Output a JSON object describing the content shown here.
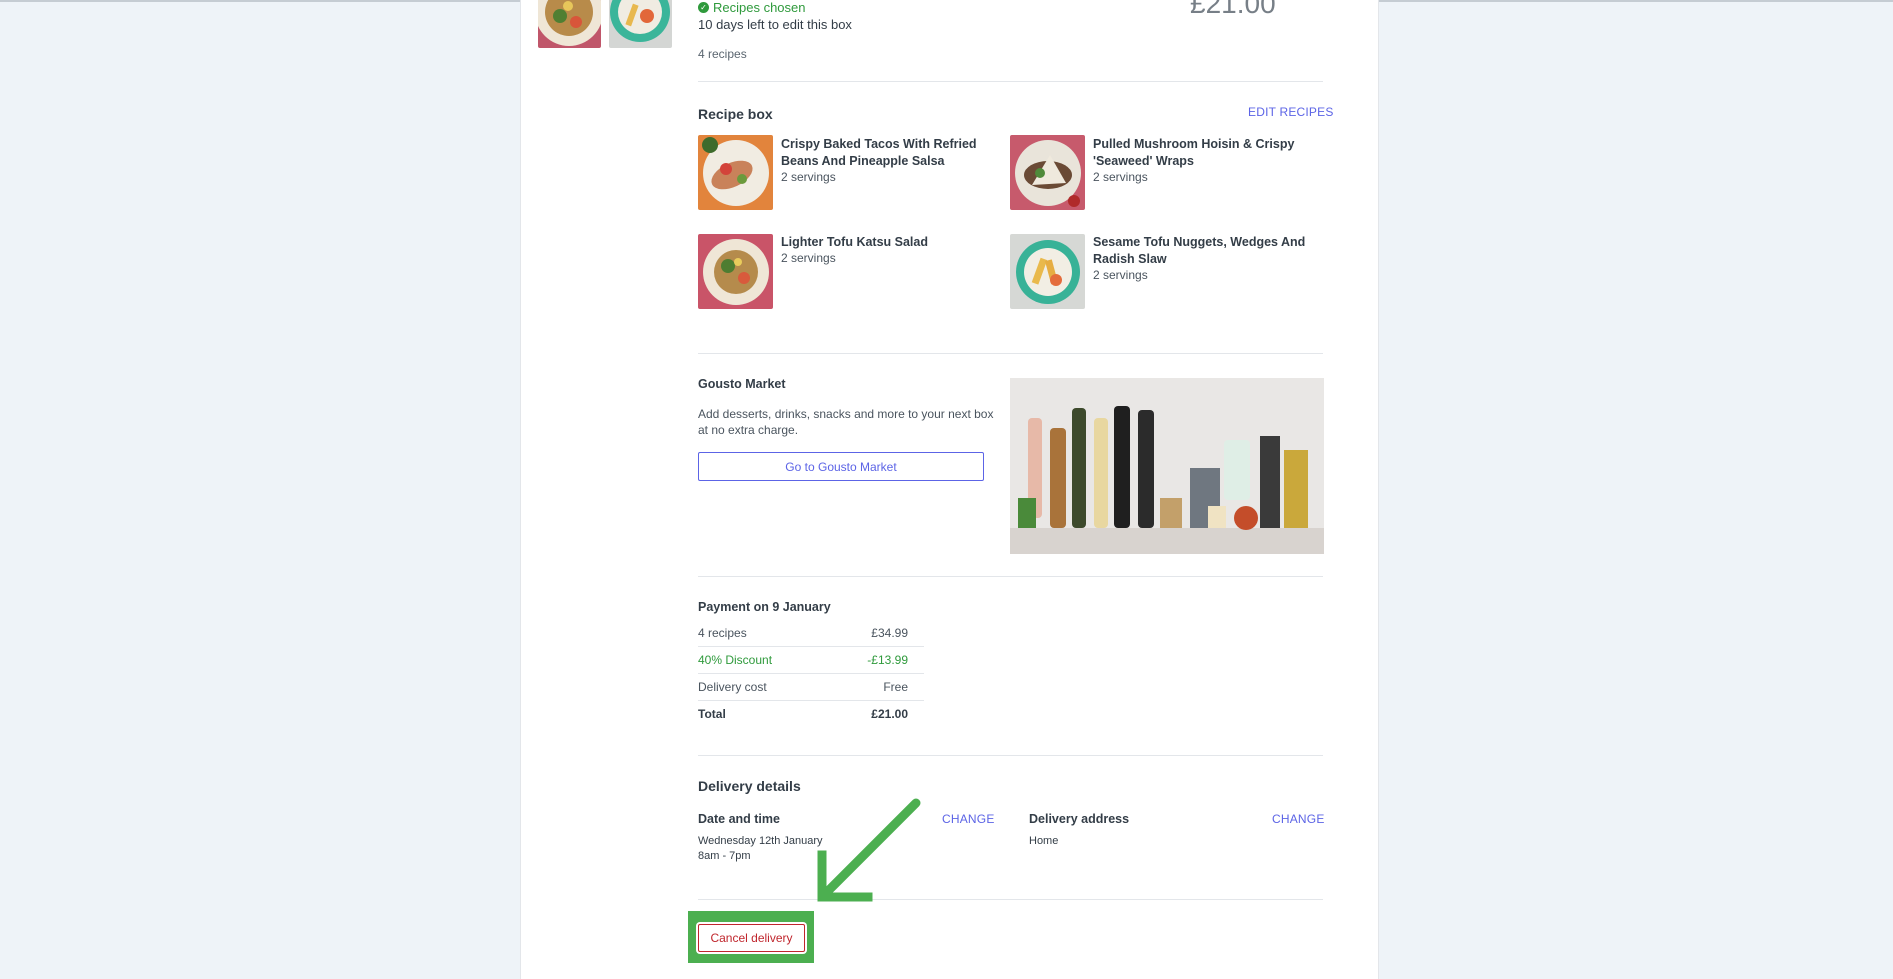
{
  "order": {
    "status": "Recipes chosen",
    "edit_deadline": "10 days left to edit this box",
    "recipe_count": "4 recipes",
    "price": "£21.00"
  },
  "recipe_box": {
    "title": "Recipe box",
    "edit_link": "EDIT RECIPES",
    "recipes": [
      {
        "name": "Crispy Baked Tacos With Refried Beans And Pineapple Salsa",
        "servings": "2 servings"
      },
      {
        "name": "Pulled Mushroom Hoisin & Crispy 'Seaweed' Wraps",
        "servings": "2 servings"
      },
      {
        "name": "Lighter Tofu Katsu Salad",
        "servings": "2 servings"
      },
      {
        "name": "Sesame Tofu Nuggets, Wedges And Radish Slaw",
        "servings": "2 servings"
      }
    ]
  },
  "market": {
    "title": "Gousto Market",
    "description": "Add desserts, drinks, snacks and more to your next box at no extra charge.",
    "button": "Go to Gousto Market"
  },
  "payment": {
    "title": "Payment on 9 January",
    "rows": [
      {
        "label": "4 recipes",
        "value": "£34.99"
      },
      {
        "label": "40% Discount",
        "value": "-£13.99"
      },
      {
        "label": "Delivery cost",
        "value": "Free"
      },
      {
        "label": "Total",
        "value": "£21.00"
      }
    ]
  },
  "delivery": {
    "title": "Delivery details",
    "date_label": "Date and time",
    "date_value": "Wednesday 12th January",
    "time_value": "8am - 7pm",
    "change_link": "CHANGE",
    "address_label": "Delivery address",
    "address_value": "Home"
  },
  "cancel_button": "Cancel delivery",
  "colors": {
    "accent": "#5c64e6",
    "success": "#2f9a3c",
    "danger": "#c0262d",
    "highlight": "#4caf50"
  }
}
